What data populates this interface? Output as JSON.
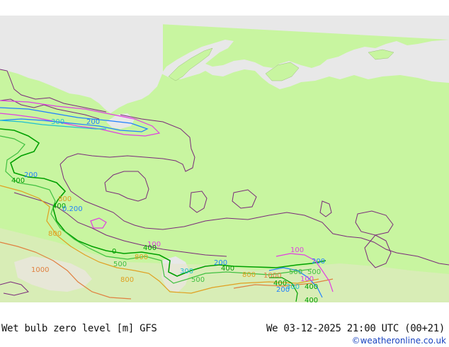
{
  "map": {
    "title": "Wet bulb zero level [m] GFS",
    "timestamp": "We 03-12-2025 21:00 UTC (00+21)",
    "credit": "©weatheronline.co.uk",
    "colors": {
      "land": "#c8f5a0",
      "sea": "#e8e8e8",
      "border": "#7a2a7a",
      "c100": "#e040e0",
      "c200": "#2080ff",
      "c300": "#20c0d0",
      "c400": "#00a000",
      "c500": "#40c040",
      "c800": "#e0a020",
      "c1000": "#e08040"
    },
    "contour_labels": [
      {
        "text": "300"
      },
      {
        "text": "200"
      },
      {
        "text": "200"
      },
      {
        "text": "400"
      },
      {
        "text": "800"
      },
      {
        "text": "400"
      },
      {
        "text": "0.200"
      },
      {
        "text": "800"
      },
      {
        "text": "1000"
      },
      {
        "text": "100"
      },
      {
        "text": "400"
      },
      {
        "text": "0"
      },
      {
        "text": "500"
      },
      {
        "text": "500"
      },
      {
        "text": "800"
      },
      {
        "text": "800"
      },
      {
        "text": "300"
      },
      {
        "text": "200"
      },
      {
        "text": "400"
      },
      {
        "text": "500"
      },
      {
        "text": "800"
      },
      {
        "text": "1000"
      },
      {
        "text": "100"
      },
      {
        "text": "500"
      },
      {
        "text": "200"
      },
      {
        "text": "400"
      },
      {
        "text": "300"
      },
      {
        "text": "400"
      },
      {
        "text": "200"
      },
      {
        "text": "100"
      },
      {
        "text": "400"
      }
    ]
  }
}
